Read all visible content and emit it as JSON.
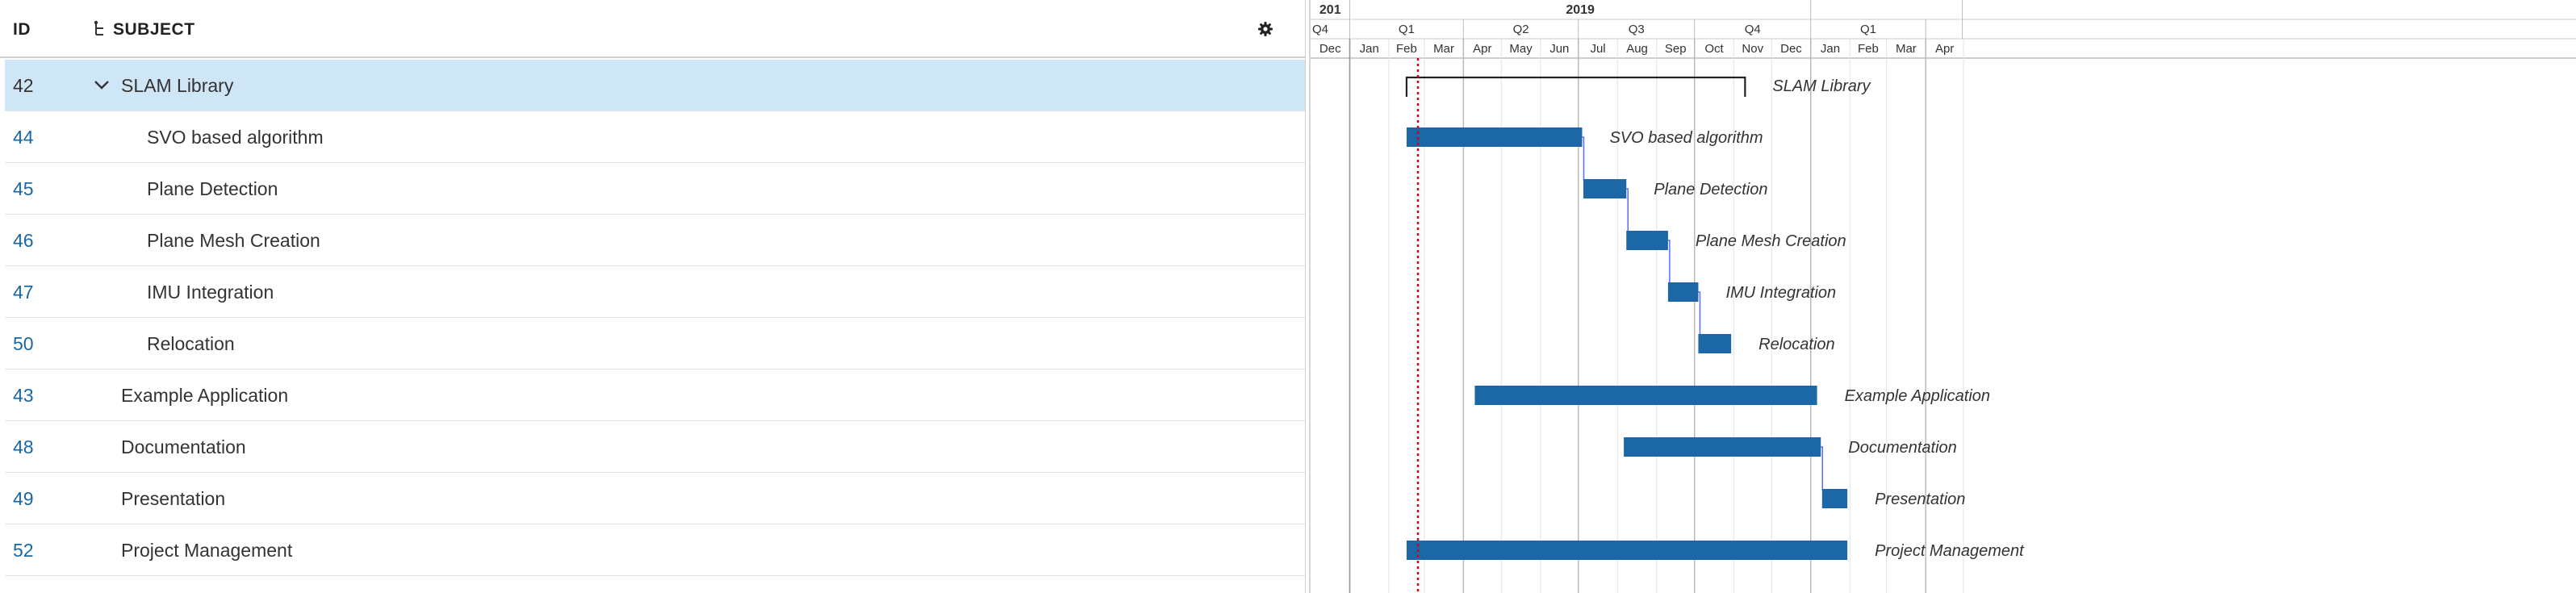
{
  "table": {
    "header": {
      "id_label": "ID",
      "subject_label": "SUBJECT"
    },
    "rows": [
      {
        "id": "42",
        "subject": "SLAM Library",
        "level": 0,
        "selected": true,
        "expandable": true
      },
      {
        "id": "44",
        "subject": "SVO based algorithm",
        "level": 1
      },
      {
        "id": "45",
        "subject": "Plane Detection",
        "level": 1
      },
      {
        "id": "46",
        "subject": "Plane Mesh Creation",
        "level": 1
      },
      {
        "id": "47",
        "subject": "IMU Integration",
        "level": 1
      },
      {
        "id": "50",
        "subject": "Relocation",
        "level": 1
      },
      {
        "id": "43",
        "subject": "Example Application",
        "level": 0
      },
      {
        "id": "48",
        "subject": "Documentation",
        "level": 0
      },
      {
        "id": "49",
        "subject": "Presentation",
        "level": 0
      },
      {
        "id": "52",
        "subject": "Project Management",
        "level": 0
      }
    ]
  },
  "timeline": {
    "years": [
      {
        "label": "201",
        "start": "2018-12-01",
        "end": "2019-01-01"
      },
      {
        "label": "2019",
        "start": "2019-01-01",
        "end": "2020-01-01"
      },
      {
        "label": "",
        "start": "2020-01-01",
        "end": "2020-04-30"
      }
    ],
    "quarters": [
      {
        "label": "Q4",
        "start": "2018-12-01",
        "end": "2019-01-01"
      },
      {
        "label": "Q1",
        "start": "2019-01-01",
        "end": "2019-04-01"
      },
      {
        "label": "Q2",
        "start": "2019-04-01",
        "end": "2019-07-01"
      },
      {
        "label": "Q3",
        "start": "2019-07-01",
        "end": "2019-10-01"
      },
      {
        "label": "Q4",
        "start": "2019-10-01",
        "end": "2020-01-01"
      },
      {
        "label": "Q1",
        "start": "2020-01-01",
        "end": "2020-04-01"
      },
      {
        "label": "",
        "start": "2020-04-01",
        "end": "2020-04-30"
      }
    ],
    "months": [
      "Dec",
      "Jan",
      "Feb",
      "Mar",
      "Apr",
      "May",
      "Jun",
      "Jul",
      "Aug",
      "Sep",
      "Oct",
      "Nov",
      "Dec",
      "Jan",
      "Feb",
      "Mar",
      "Apr"
    ],
    "months_start": "2018-12-01",
    "today": "2019-02-24"
  },
  "chart_data": {
    "type": "gantt",
    "tasks": [
      {
        "id": "42",
        "label": "SLAM Library",
        "kind": "summary",
        "start": "2019-02-15",
        "end": "2019-11-10"
      },
      {
        "id": "44",
        "label": "SVO based algorithm",
        "kind": "task",
        "start": "2019-02-15",
        "end": "2019-07-04"
      },
      {
        "id": "45",
        "label": "Plane Detection",
        "kind": "task",
        "start": "2019-07-05",
        "end": "2019-08-08"
      },
      {
        "id": "46",
        "label": "Plane Mesh Creation",
        "kind": "task",
        "start": "2019-08-08",
        "end": "2019-09-10"
      },
      {
        "id": "47",
        "label": "IMU Integration",
        "kind": "task",
        "start": "2019-09-10",
        "end": "2019-10-04"
      },
      {
        "id": "50",
        "label": "Relocation",
        "kind": "task",
        "start": "2019-10-04",
        "end": "2019-10-30"
      },
      {
        "id": "43",
        "label": "Example Application",
        "kind": "task",
        "start": "2019-04-10",
        "end": "2020-01-06"
      },
      {
        "id": "48",
        "label": "Documentation",
        "kind": "task",
        "start": "2019-08-06",
        "end": "2020-01-09"
      },
      {
        "id": "49",
        "label": "Presentation",
        "kind": "task",
        "start": "2020-01-10",
        "end": "2020-01-30"
      },
      {
        "id": "52",
        "label": "Project Management",
        "kind": "task",
        "start": "2019-02-15",
        "end": "2020-01-30"
      }
    ],
    "dependencies": [
      {
        "from": "44",
        "to": "45"
      },
      {
        "from": "45",
        "to": "46"
      },
      {
        "from": "46",
        "to": "47"
      },
      {
        "from": "47",
        "to": "50"
      },
      {
        "from": "48",
        "to": "49"
      }
    ]
  },
  "colors": {
    "bar": "#1c67a6",
    "today_line": "#d0021b",
    "selected_row": "#cfe6f7",
    "link": "#1a67a3",
    "dependency": "#5b6cff"
  },
  "icons": {
    "hierarchy": "hierarchy-icon",
    "settings": "gear-icon",
    "collapse": "chevron-down-icon"
  }
}
